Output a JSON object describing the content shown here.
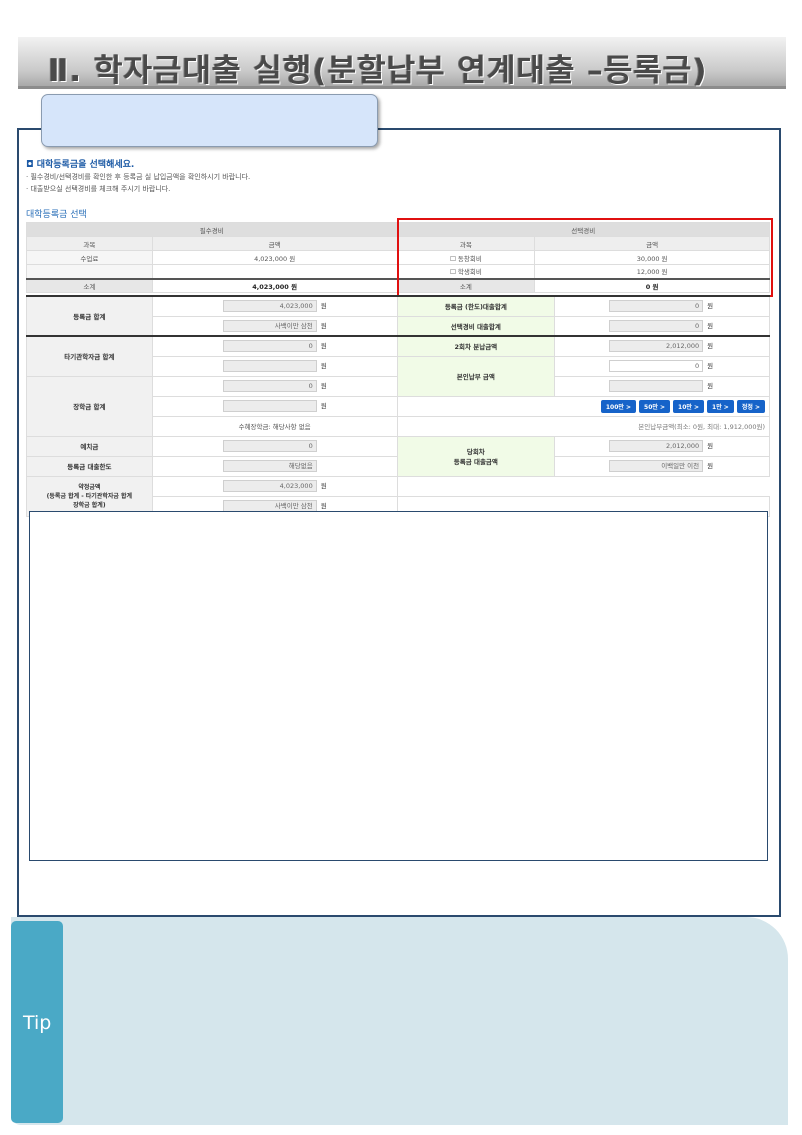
{
  "page_title": "Ⅱ. 학자금대출 실행(분할납부 연계대출 –등록금)",
  "instructions": {
    "heading": "대학등록금을 선택해세요.",
    "lines": [
      "· 필수경비/선택경비를 확인한 후 등록금 실 납입금액을 확인하시기 바랍니다.",
      "· 대출받으실 선택경비를 체크해 주시기 바랍니다."
    ]
  },
  "section_title": "대학등록금 선택",
  "fee_table": {
    "required_header": "필수경비",
    "optional_header": "선택경비",
    "col_item": "과목",
    "col_amount": "금액",
    "rows": [
      {
        "req_item": "수업료",
        "req_amount": "4,023,000 원",
        "opt_item": "동창회비",
        "opt_amount": "30,000 원"
      },
      {
        "req_item": "",
        "req_amount": "",
        "opt_item": "학생회비",
        "opt_amount": "12,000 원"
      }
    ],
    "subtotal_label": "소계",
    "req_subtotal": "4,023,000 원",
    "opt_subtotal": "0 원"
  },
  "summary": {
    "won": "원",
    "tuition_total": {
      "label": "등록금 합계",
      "value1": "4,023,000",
      "value2": "사백이만 삼천"
    },
    "tuition_loan_total": {
      "label": "등록금 (한도)대출합계",
      "value": "0"
    },
    "optional_loan_total": {
      "label": "선택경비 대출합계",
      "value": "0"
    },
    "other_loan_total": {
      "label": "타기관학자금 합계",
      "value1": "0",
      "value2": ""
    },
    "second_installment": {
      "label": "2회차 분납금액",
      "value": "2,012,000"
    },
    "self_payment": {
      "label": "본인납부 금액",
      "value1": "0",
      "value2": ""
    },
    "scholarship_total": {
      "label": "장학금 합계",
      "value1": "0",
      "value2": "",
      "note": "수혜장학금: 해당사항 없음"
    },
    "amount_buttons": [
      "100만 >",
      "50만 >",
      "10만 >",
      "1만 >",
      "정정 >"
    ],
    "self_payment_note": "본인납부금액(최소: 0원, 최대: 1,912,000원)",
    "deposit": {
      "label": "예치금",
      "value": "0"
    },
    "this_round_loan": {
      "label_line1": "당회차",
      "label_line2": "등록금 대출금액",
      "value1": "2,012,000",
      "value2": "이백일만 이천"
    },
    "tuition_loan_limit": {
      "label": "등록금 대출한도",
      "value": "해당없음"
    },
    "agreed_amount": {
      "label_line1": "약정금액",
      "label_line2": "(등록금 합계 - 타기관학자금 합계",
      "label_line3": "장학금 합계)",
      "value1": "4,023,000",
      "value2": "사백이만 삼천"
    }
  },
  "tip": {
    "label": "Tip"
  },
  "colors": {
    "frame": "#2a4a6e",
    "tab": "#d6e5fa",
    "tip_tab": "#4aa9c6",
    "tip_panel": "#d5e6ec",
    "highlight": "#e01010",
    "button": "#1663c9"
  }
}
